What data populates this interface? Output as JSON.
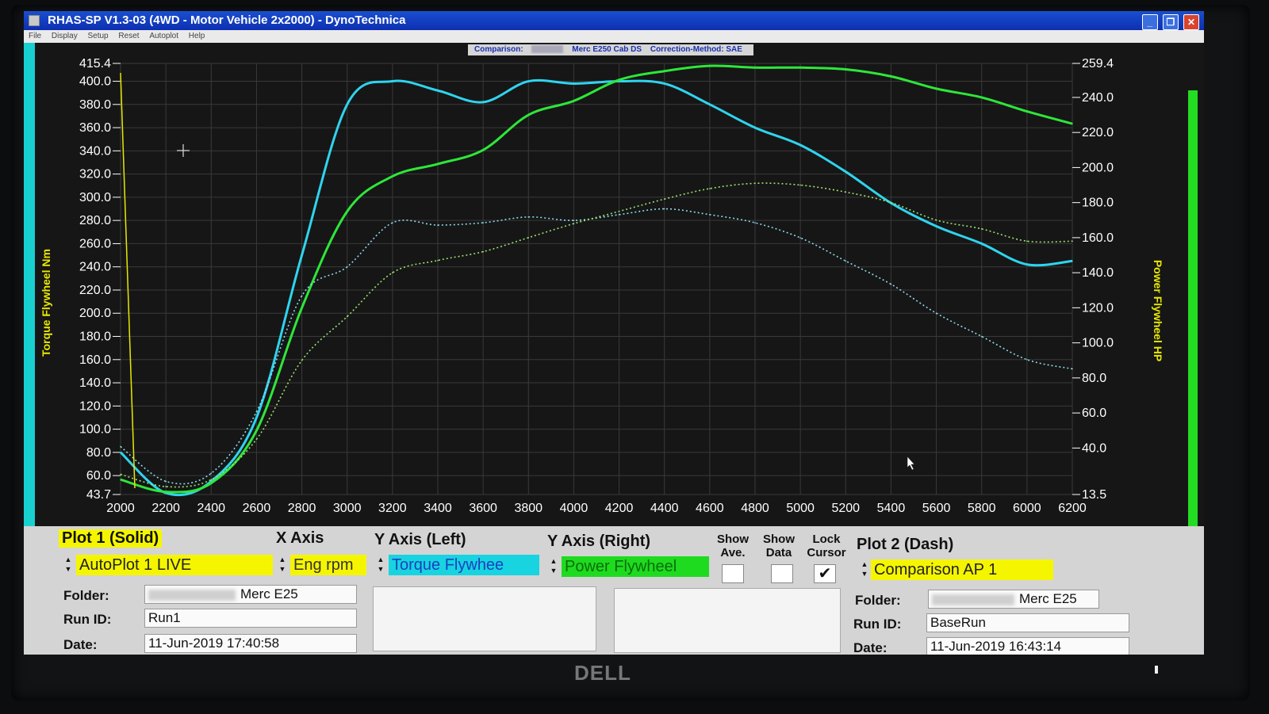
{
  "window": {
    "title": "RHAS-SP V1.3-03  (4WD - Motor Vehicle 2x2000) - DynoTechnica",
    "menu": [
      "File",
      "Display",
      "Setup",
      "Reset",
      "Autoplot",
      "Help"
    ],
    "buttons": {
      "minimize": "_",
      "restore": "❐",
      "close": "✕"
    }
  },
  "comparison_bar": {
    "comparison_label": "Comparison:",
    "vehicle": "Merc E250 Cab DS",
    "correction": "Correction-Method: SAE"
  },
  "axis_labels": {
    "left": "Torque Flywheel Nm",
    "right": "Power Flywheel HP"
  },
  "chart_data": {
    "type": "line",
    "x": [
      2000,
      2200,
      2400,
      2600,
      2800,
      3000,
      3200,
      3400,
      3600,
      3800,
      4000,
      4200,
      4400,
      4600,
      4800,
      5000,
      5200,
      5400,
      5600,
      5800,
      6000,
      6200
    ],
    "xlim": [
      2000,
      6200
    ],
    "ylim_left": [
      43.7,
      415.4
    ],
    "ylim_right": [
      13.5,
      259.4
    ],
    "x_ticks": [
      "2000",
      "2200",
      "2400",
      "2600",
      "2800",
      "3000",
      "3200",
      "3400",
      "3600",
      "3800",
      "4000",
      "4200",
      "4400",
      "4600",
      "4800",
      "5000",
      "5200",
      "5400",
      "5600",
      "5800",
      "6000",
      "6200"
    ],
    "y_left_ticks": [
      "415.4",
      "400.0",
      "380.0",
      "360.0",
      "340.0",
      "320.0",
      "300.0",
      "280.0",
      "260.0",
      "240.0",
      "220.0",
      "200.0",
      "180.0",
      "160.0",
      "140.0",
      "120.0",
      "100.0",
      "80.0",
      "60.0",
      "43.7"
    ],
    "y_right_ticks": [
      "259.4",
      "240.0",
      "220.0",
      "200.0",
      "180.0",
      "160.0",
      "140.0",
      "120.0",
      "100.0",
      "80.0",
      "60.0",
      "40.0",
      "13.5"
    ],
    "grid": true,
    "series": [
      {
        "axis": "left",
        "color": "#2fd4ee",
        "style": "solid",
        "values": [
          80,
          45,
          55,
          110,
          250,
          380,
          400,
          392,
          382,
          400,
          398,
          400,
          398,
          380,
          360,
          345,
          322,
          295,
          275,
          260,
          242,
          245
        ]
      },
      {
        "axis": "right",
        "color": "#2ee63a",
        "style": "solid",
        "values": [
          22,
          15,
          20,
          50,
          120,
          175,
          195,
          202,
          210,
          230,
          238,
          250,
          255,
          258,
          257,
          257,
          256,
          252,
          245,
          240,
          232,
          225
        ]
      },
      {
        "axis": "left",
        "color": "#8ed8e8",
        "style": "dotted",
        "values": [
          85,
          55,
          62,
          115,
          215,
          240,
          278,
          276,
          278,
          283,
          280,
          285,
          290,
          285,
          278,
          265,
          245,
          225,
          200,
          180,
          160,
          152
        ]
      },
      {
        "axis": "right",
        "color": "#9be070",
        "style": "dotted",
        "values": [
          25,
          18,
          22,
          45,
          90,
          115,
          140,
          147,
          152,
          160,
          168,
          175,
          182,
          188,
          191,
          190,
          186,
          180,
          170,
          165,
          158,
          158
        ]
      }
    ]
  },
  "controls": {
    "plot1": {
      "header": "Plot 1 (Solid)",
      "run_select": "AutoPlot 1 LIVE",
      "folder_label": "Folder:",
      "folder_value": "Merc E25",
      "runid_label": "Run ID:",
      "runid_value": "Run1",
      "date_label": "Date:",
      "date_value": "11-Jun-2019  17:40:58"
    },
    "x_axis": {
      "header": "X Axis",
      "value": "Eng rpm"
    },
    "y_axis_left": {
      "header": "Y Axis (Left)",
      "value": "Torque Flywhee"
    },
    "y_axis_right": {
      "header": "Y Axis (Right)",
      "value": "Power Flywheel"
    },
    "show_ave": {
      "label1": "Show",
      "label2": "Ave.",
      "checked": false
    },
    "show_data": {
      "label1": "Show",
      "label2": "Data",
      "checked": false
    },
    "lock_cursor": {
      "label1": "Lock",
      "label2": "Cursor",
      "checked": true,
      "mark": "✔"
    },
    "plot2": {
      "header": "Plot 2 (Dash)",
      "run_select": "Comparison AP 1",
      "folder_label": "Folder:",
      "folder_value": "Merc E25",
      "runid_label": "Run ID:",
      "runid_value": "BaseRun",
      "date_label": "Date:",
      "date_value": "11-Jun-2019  16:43:14"
    }
  },
  "monitor": {
    "brand": "DELL"
  },
  "colors": {
    "plot_bg": "#161616",
    "grid": "#3a3a3a",
    "left_axis_strip": "#19d0d0",
    "right_axis_strip": "#22dd22",
    "label_yellow": "#e8e800"
  }
}
